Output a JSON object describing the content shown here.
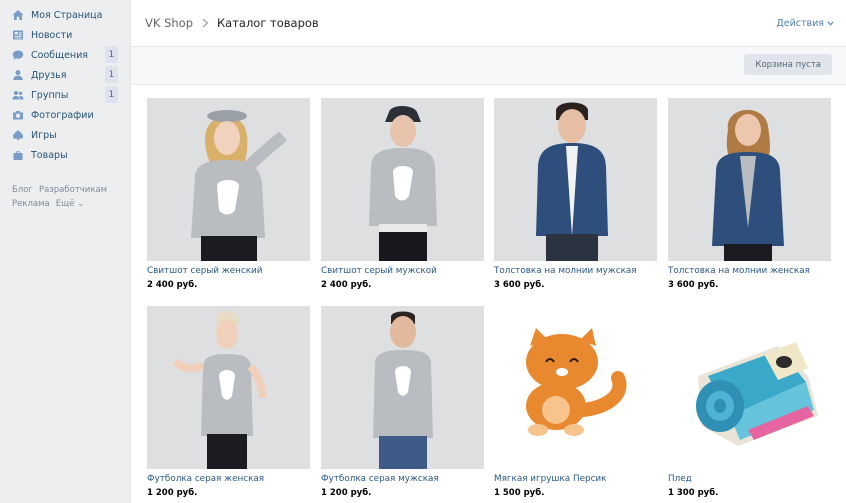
{
  "sidebar": {
    "items": [
      {
        "label": "Моя Страница",
        "icon": "home-icon",
        "badge": ""
      },
      {
        "label": "Новости",
        "icon": "news-icon",
        "badge": ""
      },
      {
        "label": "Сообщения",
        "icon": "messages-icon",
        "badge": "1"
      },
      {
        "label": "Друзья",
        "icon": "friends-icon",
        "badge": "1"
      },
      {
        "label": "Группы",
        "icon": "groups-icon",
        "badge": "1"
      },
      {
        "label": "Фотографии",
        "icon": "photos-icon",
        "badge": ""
      },
      {
        "label": "Игры",
        "icon": "games-icon",
        "badge": ""
      },
      {
        "label": "Товары",
        "icon": "goods-icon",
        "badge": ""
      }
    ],
    "footer": {
      "blog": "Блог",
      "devs": "Разработчикам",
      "ads": "Реклама",
      "more": "Ещё ⌄"
    }
  },
  "header": {
    "shop": "VK Shop",
    "current": "Каталог товаров",
    "actions": "Действия"
  },
  "cart": {
    "label": "Корзина пуста"
  },
  "products": [
    {
      "title": "Свитшот серый женский",
      "price": "2 400 руб.",
      "image": "woman-grey-sweatshirt"
    },
    {
      "title": "Свитшот серый мужской",
      "price": "2 400 руб.",
      "image": "man-grey-sweatshirt"
    },
    {
      "title": "Толстовка на молнии мужская",
      "price": "3 600 руб.",
      "image": "man-blue-zip-hoodie"
    },
    {
      "title": "Толстовка на молнии женская",
      "price": "3 600 руб.",
      "image": "woman-blue-zip-hoodie"
    },
    {
      "title": "Футболка серая женская",
      "price": "1 200 руб.",
      "image": "woman-grey-tshirt"
    },
    {
      "title": "Футболка серая мужская",
      "price": "1 200 руб.",
      "image": "man-grey-tshirt"
    },
    {
      "title": "Мягкая игрушка Персик",
      "price": "1 500 руб.",
      "image": "plush-orange-cat"
    },
    {
      "title": "Плед",
      "price": "1 300 руб.",
      "image": "rolled-blanket"
    }
  ],
  "colors": {
    "accent": "#5181b8",
    "link": "#2a5885",
    "background": "#edeef0",
    "sweater_grey": "#b9bcc0",
    "hoodie_blue": "#2e4f7c",
    "cat_orange": "#e8892f",
    "blanket_teal": "#3aa9c9"
  }
}
